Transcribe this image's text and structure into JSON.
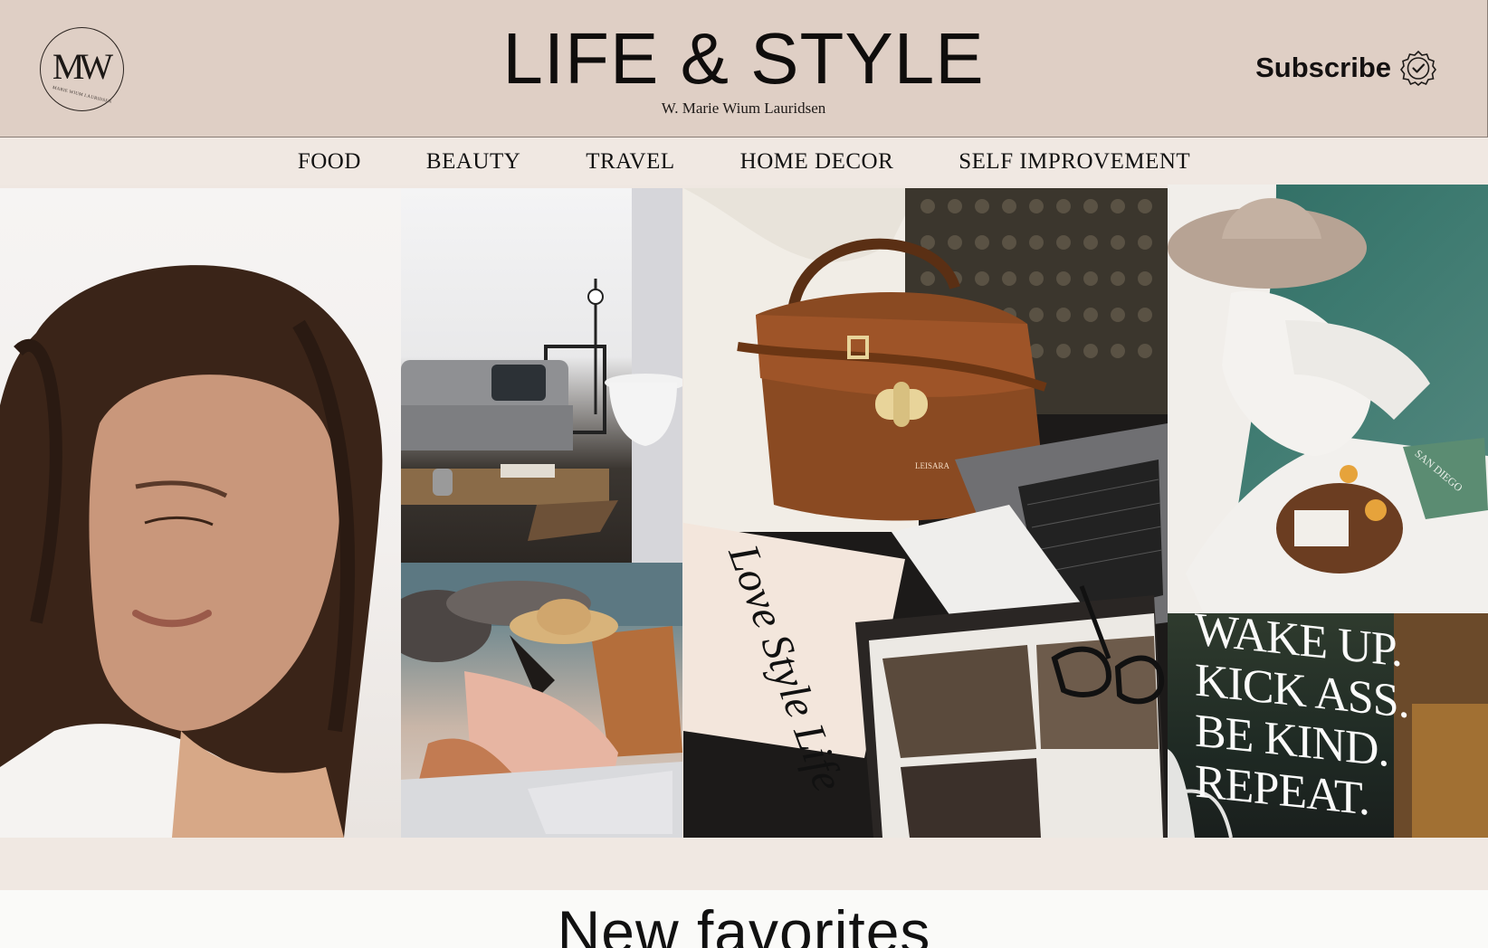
{
  "header": {
    "logo_text": "MW",
    "logo_subtext": "MARIE WIUM LAURIDSEN",
    "title": "LIFE & STYLE",
    "subtitle": "W. Marie Wium Lauridsen",
    "subscribe_label": "Subscribe",
    "subscribe_icon": "verified-badge-icon"
  },
  "nav": {
    "items": [
      {
        "label": "FOOD"
      },
      {
        "label": "BEAUTY"
      },
      {
        "label": "TRAVEL"
      },
      {
        "label": "HOME DECOR"
      },
      {
        "label": "SELF IMPROVEMENT"
      }
    ]
  },
  "gallery": {
    "poster_text": "WAKE UP. KICK ASS. BE KIND. REPEAT.",
    "book_text": "Love Style Life",
    "bag_text": "LEISARA",
    "book2_text": "SAN DIEGO"
  },
  "section": {
    "title": "New favorites"
  },
  "colors": {
    "header_bg": "#dfcfc5",
    "page_bg": "#f0e8e2",
    "text": "#111111"
  }
}
